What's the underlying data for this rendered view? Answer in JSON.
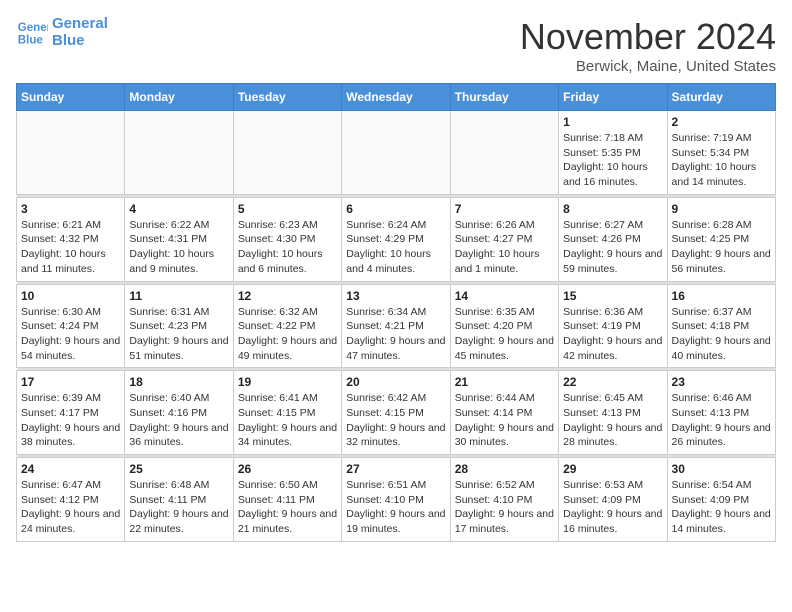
{
  "logo": {
    "line1": "General",
    "line2": "Blue"
  },
  "header": {
    "title": "November 2024",
    "location": "Berwick, Maine, United States"
  },
  "weekdays": [
    "Sunday",
    "Monday",
    "Tuesday",
    "Wednesday",
    "Thursday",
    "Friday",
    "Saturday"
  ],
  "weeks": [
    [
      {
        "day": "",
        "info": ""
      },
      {
        "day": "",
        "info": ""
      },
      {
        "day": "",
        "info": ""
      },
      {
        "day": "",
        "info": ""
      },
      {
        "day": "",
        "info": ""
      },
      {
        "day": "1",
        "info": "Sunrise: 7:18 AM\nSunset: 5:35 PM\nDaylight: 10 hours and 16 minutes."
      },
      {
        "day": "2",
        "info": "Sunrise: 7:19 AM\nSunset: 5:34 PM\nDaylight: 10 hours and 14 minutes."
      }
    ],
    [
      {
        "day": "3",
        "info": "Sunrise: 6:21 AM\nSunset: 4:32 PM\nDaylight: 10 hours and 11 minutes."
      },
      {
        "day": "4",
        "info": "Sunrise: 6:22 AM\nSunset: 4:31 PM\nDaylight: 10 hours and 9 minutes."
      },
      {
        "day": "5",
        "info": "Sunrise: 6:23 AM\nSunset: 4:30 PM\nDaylight: 10 hours and 6 minutes."
      },
      {
        "day": "6",
        "info": "Sunrise: 6:24 AM\nSunset: 4:29 PM\nDaylight: 10 hours and 4 minutes."
      },
      {
        "day": "7",
        "info": "Sunrise: 6:26 AM\nSunset: 4:27 PM\nDaylight: 10 hours and 1 minute."
      },
      {
        "day": "8",
        "info": "Sunrise: 6:27 AM\nSunset: 4:26 PM\nDaylight: 9 hours and 59 minutes."
      },
      {
        "day": "9",
        "info": "Sunrise: 6:28 AM\nSunset: 4:25 PM\nDaylight: 9 hours and 56 minutes."
      }
    ],
    [
      {
        "day": "10",
        "info": "Sunrise: 6:30 AM\nSunset: 4:24 PM\nDaylight: 9 hours and 54 minutes."
      },
      {
        "day": "11",
        "info": "Sunrise: 6:31 AM\nSunset: 4:23 PM\nDaylight: 9 hours and 51 minutes."
      },
      {
        "day": "12",
        "info": "Sunrise: 6:32 AM\nSunset: 4:22 PM\nDaylight: 9 hours and 49 minutes."
      },
      {
        "day": "13",
        "info": "Sunrise: 6:34 AM\nSunset: 4:21 PM\nDaylight: 9 hours and 47 minutes."
      },
      {
        "day": "14",
        "info": "Sunrise: 6:35 AM\nSunset: 4:20 PM\nDaylight: 9 hours and 45 minutes."
      },
      {
        "day": "15",
        "info": "Sunrise: 6:36 AM\nSunset: 4:19 PM\nDaylight: 9 hours and 42 minutes."
      },
      {
        "day": "16",
        "info": "Sunrise: 6:37 AM\nSunset: 4:18 PM\nDaylight: 9 hours and 40 minutes."
      }
    ],
    [
      {
        "day": "17",
        "info": "Sunrise: 6:39 AM\nSunset: 4:17 PM\nDaylight: 9 hours and 38 minutes."
      },
      {
        "day": "18",
        "info": "Sunrise: 6:40 AM\nSunset: 4:16 PM\nDaylight: 9 hours and 36 minutes."
      },
      {
        "day": "19",
        "info": "Sunrise: 6:41 AM\nSunset: 4:15 PM\nDaylight: 9 hours and 34 minutes."
      },
      {
        "day": "20",
        "info": "Sunrise: 6:42 AM\nSunset: 4:15 PM\nDaylight: 9 hours and 32 minutes."
      },
      {
        "day": "21",
        "info": "Sunrise: 6:44 AM\nSunset: 4:14 PM\nDaylight: 9 hours and 30 minutes."
      },
      {
        "day": "22",
        "info": "Sunrise: 6:45 AM\nSunset: 4:13 PM\nDaylight: 9 hours and 28 minutes."
      },
      {
        "day": "23",
        "info": "Sunrise: 6:46 AM\nSunset: 4:13 PM\nDaylight: 9 hours and 26 minutes."
      }
    ],
    [
      {
        "day": "24",
        "info": "Sunrise: 6:47 AM\nSunset: 4:12 PM\nDaylight: 9 hours and 24 minutes."
      },
      {
        "day": "25",
        "info": "Sunrise: 6:48 AM\nSunset: 4:11 PM\nDaylight: 9 hours and 22 minutes."
      },
      {
        "day": "26",
        "info": "Sunrise: 6:50 AM\nSunset: 4:11 PM\nDaylight: 9 hours and 21 minutes."
      },
      {
        "day": "27",
        "info": "Sunrise: 6:51 AM\nSunset: 4:10 PM\nDaylight: 9 hours and 19 minutes."
      },
      {
        "day": "28",
        "info": "Sunrise: 6:52 AM\nSunset: 4:10 PM\nDaylight: 9 hours and 17 minutes."
      },
      {
        "day": "29",
        "info": "Sunrise: 6:53 AM\nSunset: 4:09 PM\nDaylight: 9 hours and 16 minutes."
      },
      {
        "day": "30",
        "info": "Sunrise: 6:54 AM\nSunset: 4:09 PM\nDaylight: 9 hours and 14 minutes."
      }
    ]
  ]
}
